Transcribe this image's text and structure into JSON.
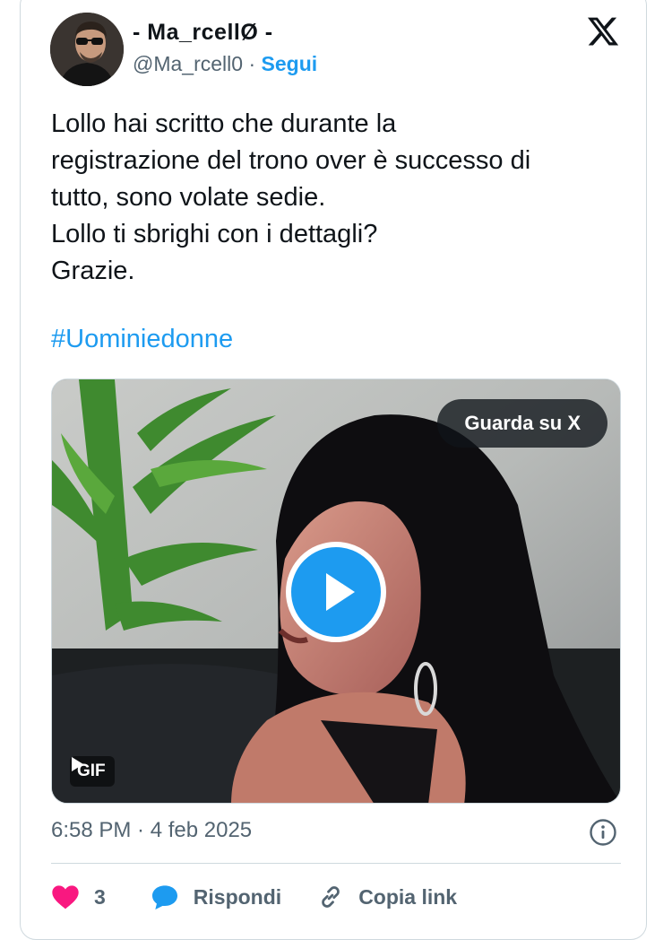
{
  "author": {
    "display_name": "- Ma_rcellØ -",
    "handle": "@Ma_rcell0",
    "separator": " · ",
    "follow_label": "Segui"
  },
  "tweet": {
    "text": "Lollo hai scritto che durante la\nregistrazione del trono over è successo di\ntutto, sono volate sedie.\nLollo ti sbrighi con i dettagli?\nGrazie.",
    "hashtag": "#Uominiedonne"
  },
  "media": {
    "watch_label": "Guarda su X",
    "gif_label": "GIF"
  },
  "meta": {
    "time": "6:58 PM",
    "separator": " · ",
    "date": "4 feb 2025"
  },
  "actions": {
    "like_count": "3",
    "reply_label": "Rispondi",
    "copy_label": "Copia link"
  },
  "colors": {
    "accent": "#1d9bf0",
    "like": "#f91880",
    "muted": "#536471"
  },
  "icons": [
    "x-logo-icon",
    "play-icon",
    "info-icon",
    "heart-icon",
    "reply-bubble-icon",
    "link-icon"
  ]
}
